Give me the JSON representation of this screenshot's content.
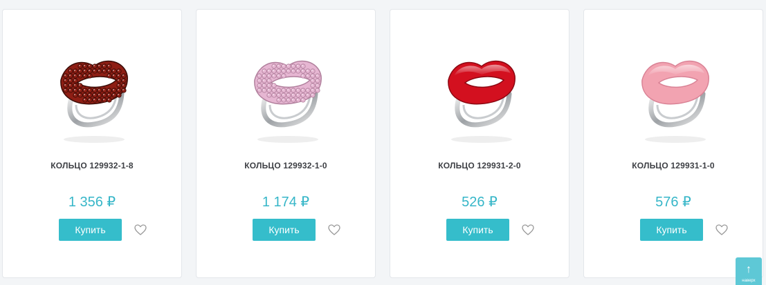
{
  "products": [
    {
      "title": "КОЛЬЦО 129932-1-8",
      "price": "1 356 ₽",
      "buy_label": "Купить",
      "stone_color": "#8e1e14",
      "stone_dark": "#3a0c07",
      "style": "stones"
    },
    {
      "title": "КОЛЬЦО 129932-1-0",
      "price": "1 174 ₽",
      "buy_label": "Купить",
      "stone_color": "#e6b6d2",
      "stone_dark": "#b07f9c",
      "style": "stones"
    },
    {
      "title": "КОЛЬЦО 129931-2-0",
      "price": "526 ₽",
      "buy_label": "Купить",
      "stone_color": "#d3101f",
      "stone_dark": "#8a0812",
      "style": "enamel"
    },
    {
      "title": "КОЛЬЦО 129931-1-0",
      "price": "576 ₽",
      "buy_label": "Купить",
      "stone_color": "#f2a3b1",
      "stone_dark": "#d98295",
      "style": "enamel"
    }
  ],
  "scroll_up": {
    "arrow": "↑",
    "label": "наверх"
  },
  "colors": {
    "accent": "#35bdcb",
    "price": "#36b6c8",
    "heart": "#9a9a9a"
  },
  "icons": {
    "favorite": "heart-outline-icon",
    "scroll_up": "arrow-up-icon"
  }
}
